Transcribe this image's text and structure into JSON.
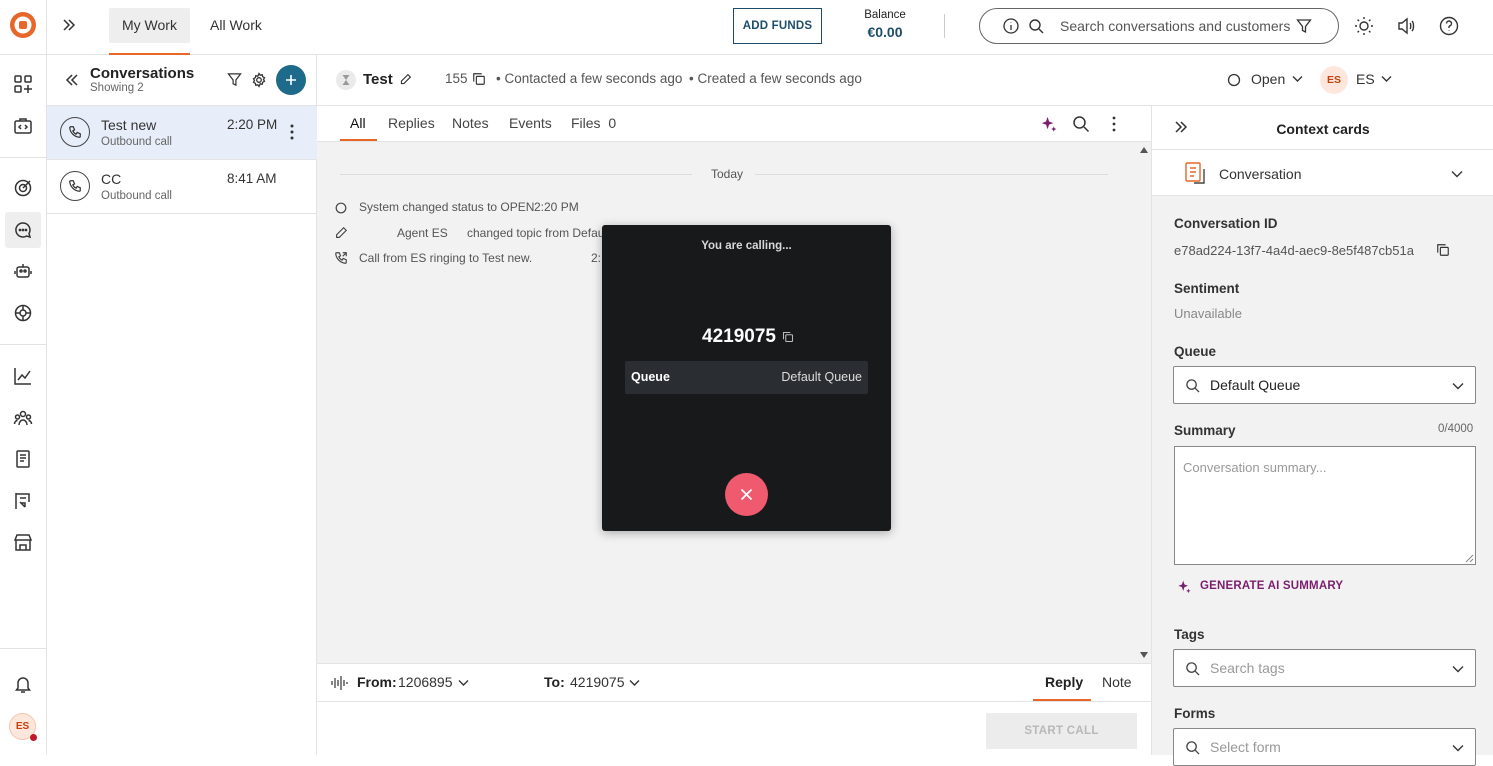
{
  "topbar": {
    "tabs": [
      "My Work",
      "All Work"
    ],
    "add_funds": "ADD FUNDS",
    "balance_label": "Balance",
    "balance_value": "€0.00",
    "search_placeholder": "Search conversations and customers"
  },
  "rail": {
    "user_initials": "ES"
  },
  "conversations": {
    "title": "Conversations",
    "showing": "Showing 2",
    "items": [
      {
        "name": "Test new",
        "sub": "Outbound call",
        "time": "2:20 PM"
      },
      {
        "name": "CC",
        "sub": "Outbound call",
        "time": "8:41 AM"
      }
    ]
  },
  "header": {
    "name": "Test",
    "count": "155",
    "contacted": "• Contacted a few seconds ago",
    "created": "• Created a few seconds ago",
    "status": "Open",
    "assignee_initials": "ES",
    "assignee": "ES"
  },
  "tabs": {
    "all": "All",
    "replies": "Replies",
    "notes": "Notes",
    "events": "Events",
    "files": "Files",
    "files_count": "0"
  },
  "timeline": {
    "day": "Today",
    "event1": "System changed status to OPEN",
    "event1_time": "2:20 PM",
    "event2_agent": "Agent ES",
    "event2_text": "changed topic from Default",
    "event3": "Call from ES ringing to Test new.",
    "event3_time": "2:"
  },
  "call": {
    "title": "You are calling...",
    "number": "4219075",
    "queue_label": "Queue",
    "queue_value": "Default Queue"
  },
  "composer": {
    "from_label": "From:",
    "from_value": "1206895",
    "to_label": "To:",
    "to_value": "4219075",
    "reply": "Reply",
    "note": "Note",
    "start_call": "START CALL"
  },
  "right": {
    "title": "Context cards",
    "section": "Conversation",
    "conv_id_label": "Conversation ID",
    "conv_id": "e78ad224-13f7-4a4d-aec9-8e5f487cb51a",
    "sentiment_label": "Sentiment",
    "sentiment_value": "Unavailable",
    "queue_label": "Queue",
    "queue_value": "Default Queue",
    "summary_label": "Summary",
    "summary_count": "0/4000",
    "summary_placeholder": "Conversation summary...",
    "generate": "GENERATE AI SUMMARY",
    "tags_label": "Tags",
    "tags_placeholder": "Search tags",
    "forms_label": "Forms",
    "forms_placeholder": "Select form"
  },
  "colors": {
    "brand": "#e8662a",
    "primary": "#1d4d6a",
    "selected_row": "#e8eef9",
    "hangup": "#ef5a6f",
    "ai": "#7a1f6e"
  }
}
